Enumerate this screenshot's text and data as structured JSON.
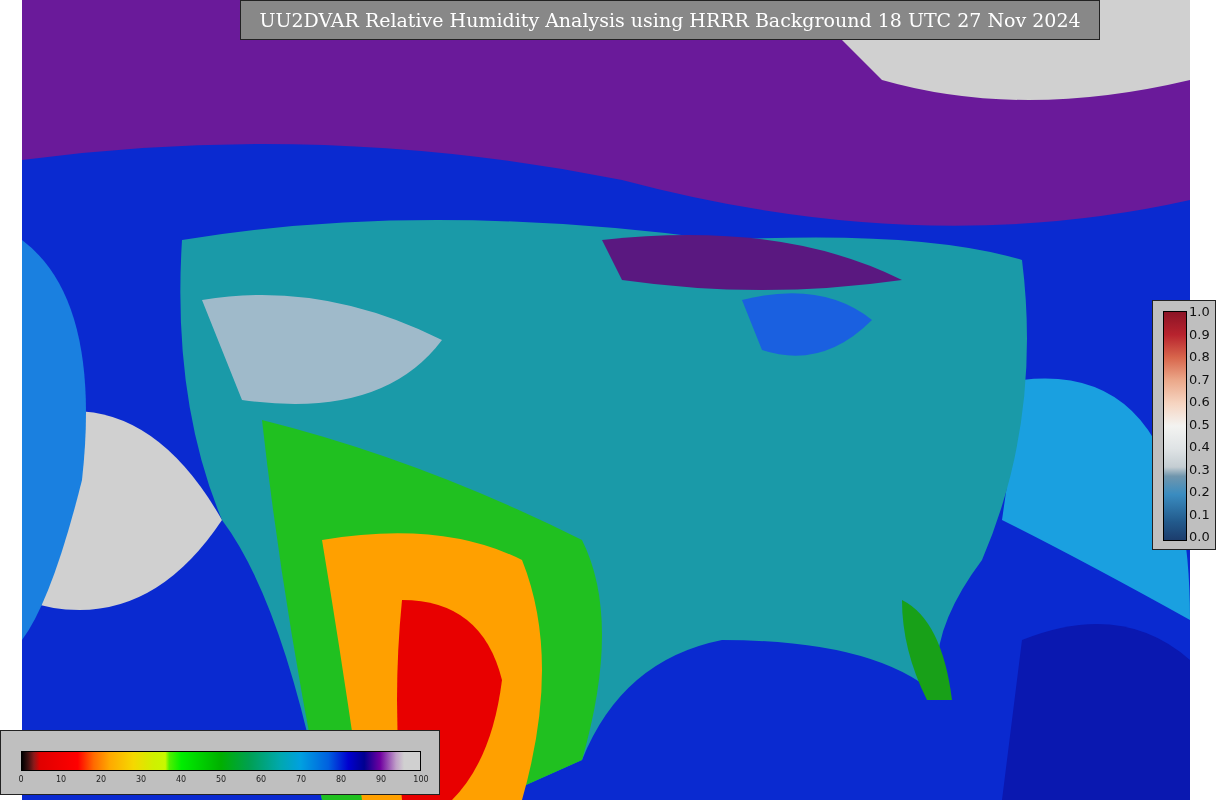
{
  "title": "UU2DVAR Relative Humidity Analysis using HRRR Background 18 UTC 27 Nov 2024",
  "ratio_legend": {
    "ticks": [
      "1.0",
      "0.9",
      "0.8",
      "0.7",
      "0.6",
      "0.5",
      "0.4",
      "0.3",
      "0.2",
      "0.1",
      "0.0"
    ]
  },
  "humidity_legend": {
    "ticks": [
      "0",
      "10",
      "20",
      "30",
      "40",
      "50",
      "60",
      "70",
      "80",
      "90",
      "100"
    ]
  }
}
